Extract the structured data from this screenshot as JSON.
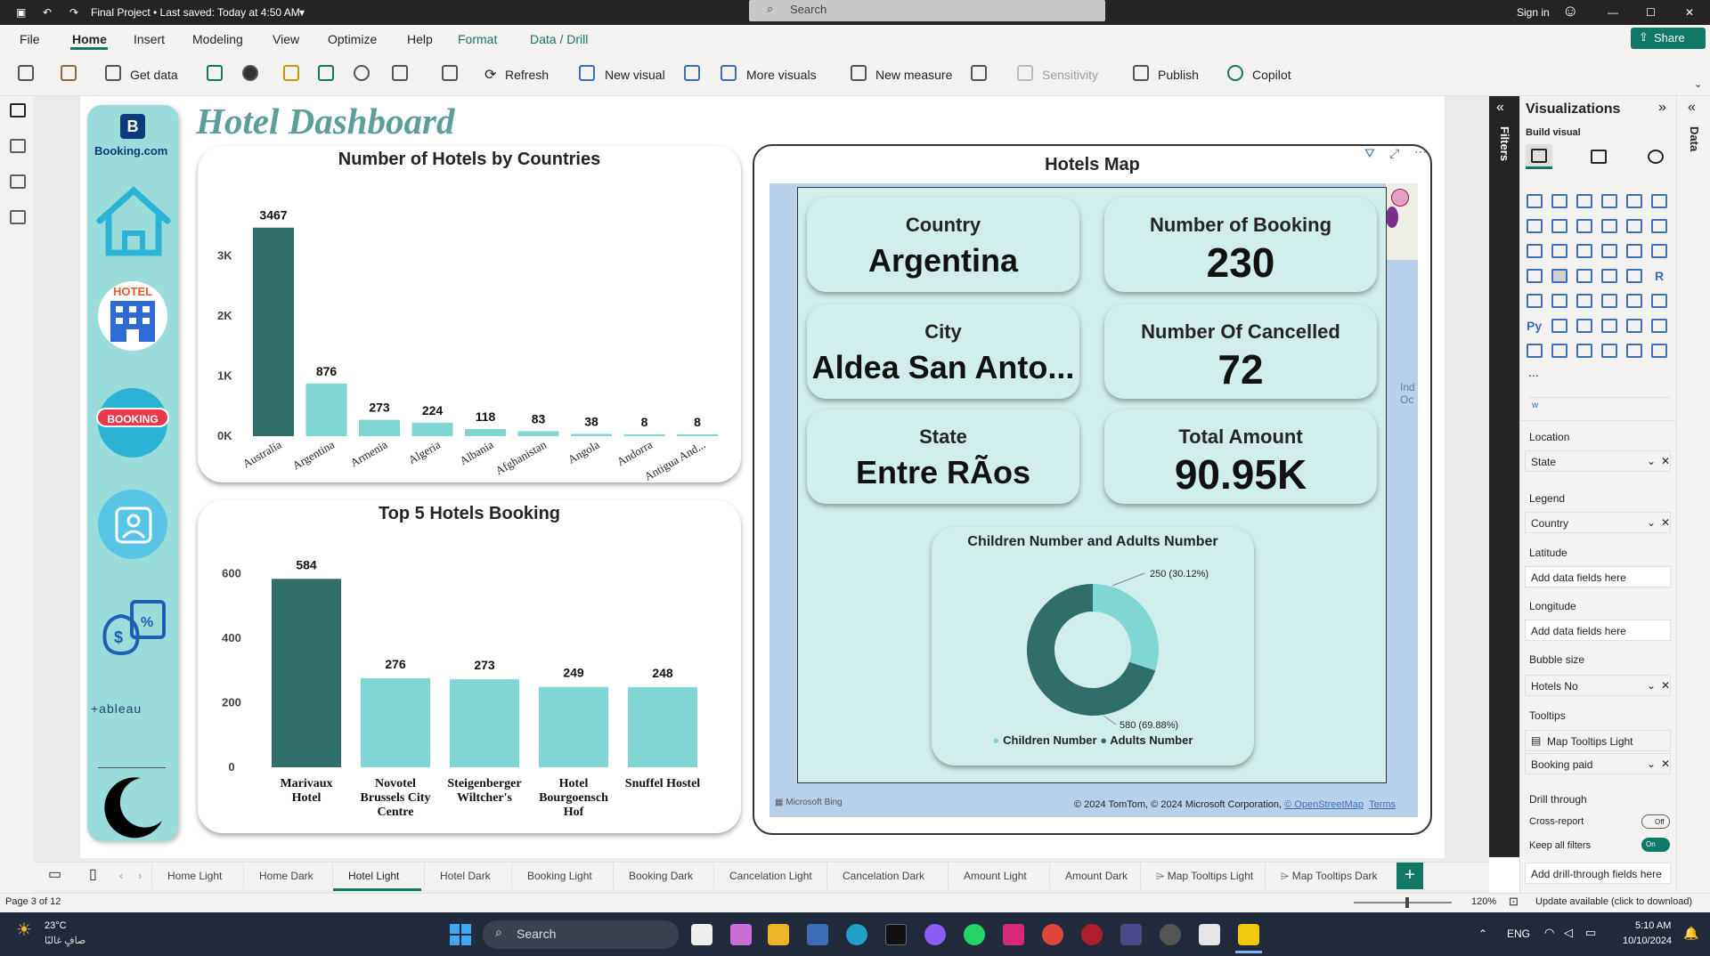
{
  "titlebar": {
    "file_title": "Final Project • Last saved: Today at 4:50 AM",
    "search_placeholder": "Search",
    "sign_in": "Sign in"
  },
  "menu": {
    "items": [
      "File",
      "Home",
      "Insert",
      "Modeling",
      "View",
      "Optimize",
      "Help",
      "Format",
      "Data / Drill"
    ],
    "share": "Share"
  },
  "ribbon": {
    "get_data": "Get data",
    "refresh": "Refresh",
    "new_visual": "New visual",
    "more_visuals": "More visuals",
    "new_measure": "New measure",
    "sensitivity": "Sensitivity",
    "publish": "Publish",
    "copilot": "Copilot"
  },
  "nav": {
    "booking_logo": "Booking.com",
    "hotel_badge": "HOTEL",
    "booking_badge": "BOOKING",
    "tableau_logo": "+ableau"
  },
  "dashboard": {
    "title": "Hotel Dashboard"
  },
  "chart_data": [
    {
      "type": "bar",
      "title": "Number of Hotels by Countries",
      "categories": [
        "Australia",
        "Argentina",
        "Armenia",
        "Algeria",
        "Albania",
        "Afghanistan",
        "Angola",
        "Andorra",
        "Antigua And..."
      ],
      "values": [
        3467,
        876,
        273,
        224,
        118,
        83,
        38,
        8,
        8
      ],
      "yticks": [
        "0K",
        "1K",
        "2K",
        "3K"
      ],
      "ylim": [
        0,
        3700
      ],
      "highlight": "Australia",
      "colors": {
        "highlight": "#2f6e69",
        "normal": "#7fd6d3"
      }
    },
    {
      "type": "bar",
      "title": "Top 5 Hotels Booking",
      "categories": [
        "Marivaux Hotel",
        "Novotel Brussels City Centre",
        "Steigenberger Wiltcher's",
        "Hotel Bourgoensch Hof",
        "Snuffel Hostel"
      ],
      "values": [
        584,
        276,
        273,
        249,
        248
      ],
      "yticks": [
        "0",
        "200",
        "400",
        "600"
      ],
      "ylim": [
        0,
        640
      ],
      "highlight": "Marivaux Hotel",
      "colors": {
        "highlight": "#2f6e69",
        "normal": "#7fd6d3"
      }
    },
    {
      "type": "pie",
      "title": "Children Number and Adults Number",
      "series": [
        {
          "name": "Children Number",
          "value": 250,
          "label": "250 (30.12%)",
          "color": "#7fd6d3"
        },
        {
          "name": "Adults Number",
          "value": 580,
          "label": "580 (69.88%)",
          "color": "#2f6e69"
        }
      ]
    }
  ],
  "map": {
    "title": "Hotels Map",
    "bing": "Microsoft Bing",
    "attribution": "© 2024 TomTom, © 2024 Microsoft Corporation,",
    "osm": "© OpenStreetMap",
    "terms": "Terms",
    "ocean_label": "Ind\nOc"
  },
  "kpis": [
    {
      "label": "Country",
      "value": "Argentina"
    },
    {
      "label": "Number of Booking",
      "value": "230"
    },
    {
      "label": "City",
      "value": "Aldea San Anto..."
    },
    {
      "label": "Number Of Cancelled",
      "value": "72"
    },
    {
      "label": "State",
      "value": "Entre RÃos"
    },
    {
      "label": "Total Amount",
      "value": "90.95K"
    }
  ],
  "viz": {
    "title": "Visualizations",
    "build": "Build visual",
    "filters": "Filters",
    "data": "Data",
    "more": "...",
    "wells": [
      {
        "label": "Location",
        "field": "State"
      },
      {
        "label": "Legend",
        "field": "Country"
      },
      {
        "label": "Latitude",
        "field": "Add data fields here"
      },
      {
        "label": "Longitude",
        "field": "Add data fields here"
      },
      {
        "label": "Bubble size",
        "field": "Hotels No"
      },
      {
        "label": "Tooltips",
        "field": "Map Tooltips Light"
      }
    ],
    "tooltip2": "Booking paid",
    "drill_through": "Drill through",
    "cross_report": "Cross-report",
    "cross_state": "Off",
    "keep_filters": "Keep all filters",
    "keep_state": "On",
    "add_drill": "Add drill-through fields here"
  },
  "tabs": [
    "Home Light",
    "Home Dark",
    "Hotel Light",
    "Hotel Dark",
    "Booking Light",
    "Booking Dark",
    "Cancelation Light",
    "Cancelation Dark",
    "Amount Light",
    "Amount Dark",
    "Map Tooltips Light",
    "Map Tooltips Dark"
  ],
  "status": {
    "page": "Page 3 of 12",
    "zoom": "120%",
    "update": "Update available (click to download)"
  },
  "taskbar": {
    "temp": "23°C",
    "weather": "صافٍ غالبًا",
    "search": "Search",
    "lang": "ENG",
    "time": "5:10 AM",
    "date": "10/10/2024"
  }
}
